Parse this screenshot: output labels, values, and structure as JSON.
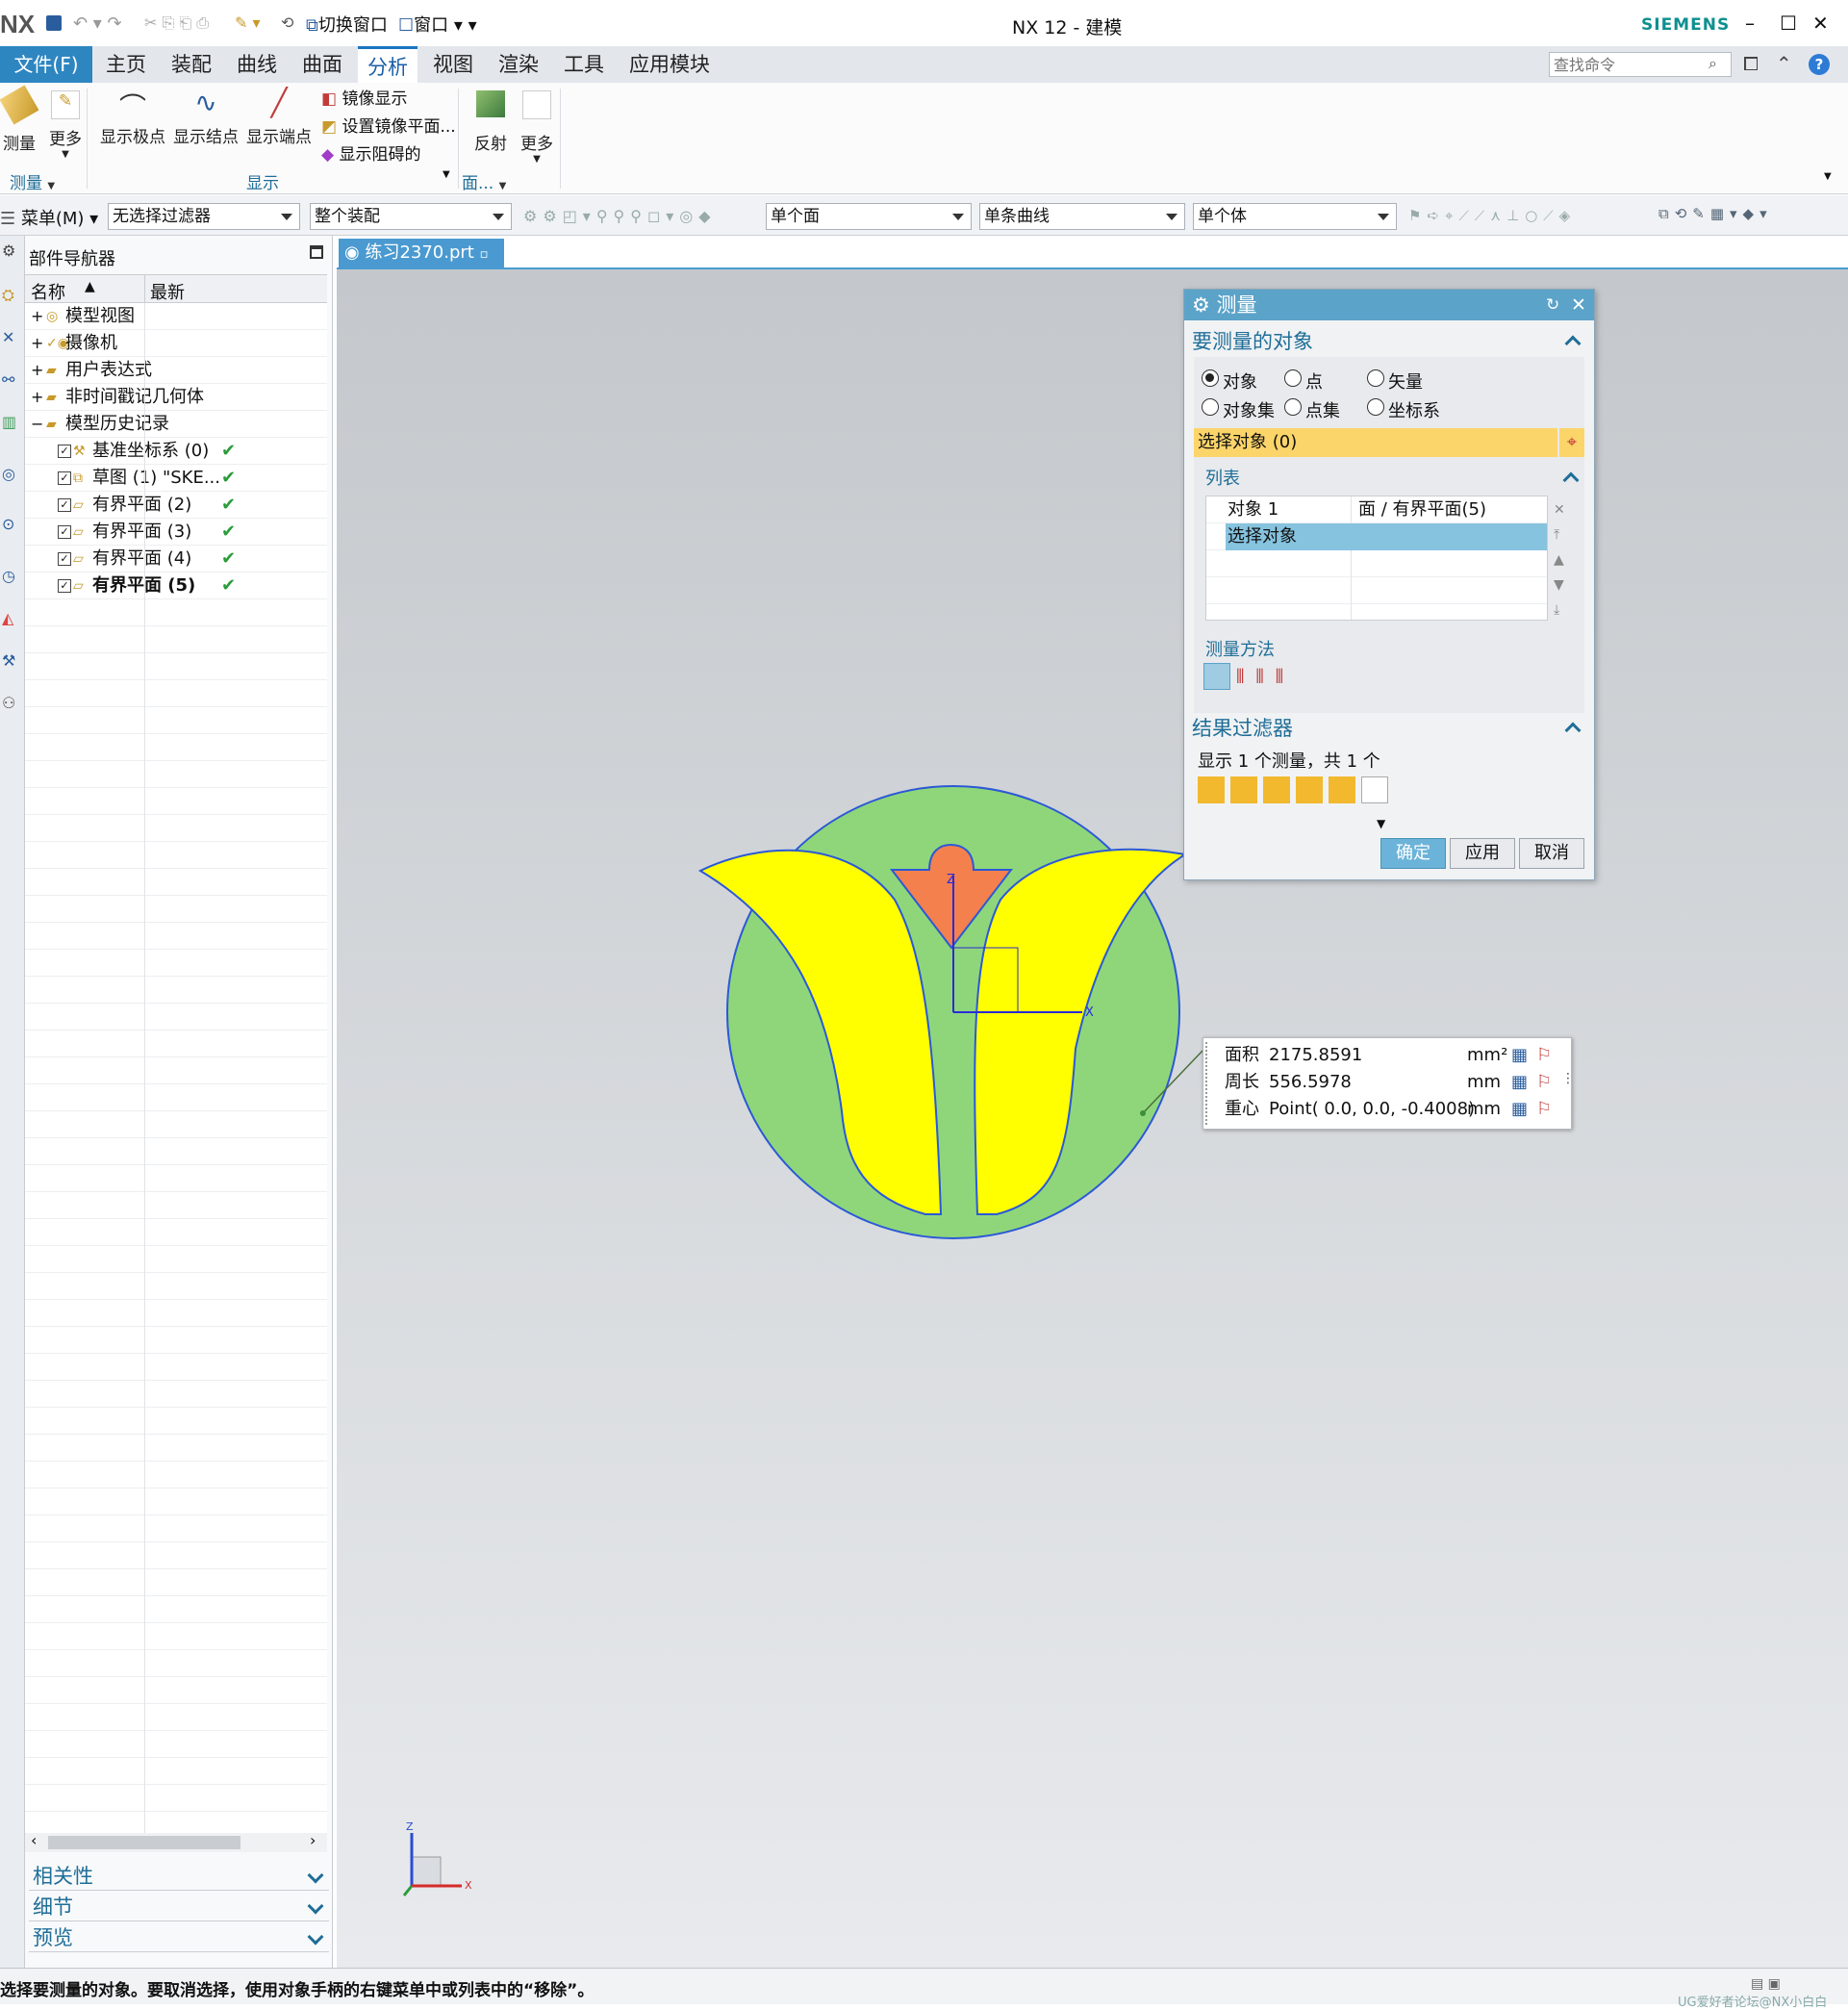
{
  "titlebar": {
    "logo": "NX",
    "quick": [
      "切换窗口",
      "窗口"
    ],
    "title": "NX 12 - 建模",
    "brand": "SIEMENS"
  },
  "menubar": {
    "file": "文件(F)",
    "tabs": [
      "主页",
      "装配",
      "曲线",
      "曲面",
      "分析",
      "视图",
      "渲染",
      "工具",
      "应用模块"
    ],
    "active_tab": "分析",
    "search_placeholder": "查找命令"
  },
  "ribbon": {
    "measure": "测量",
    "more1": "更多",
    "show_poles": "显示极点",
    "show_knots": "显示结点",
    "show_ends": "显示端点",
    "mirror_show": "镜像显示",
    "set_mirror_plane": "设置镜像平面...",
    "show_blocked": "显示阻碍的",
    "reflect": "反射",
    "more2": "更多",
    "group_measure": "测量",
    "group_show": "显示",
    "group_face": "面..."
  },
  "selbar": {
    "menu": "菜单(M)",
    "filter": "无选择过滤器",
    "assembly": "整个装配",
    "face_rule": "单个面",
    "curve_rule": "单条曲线",
    "body_rule": "单个体"
  },
  "navigator": {
    "title": "部件导航器",
    "col_name": "名称",
    "col_latest": "最新",
    "items": [
      {
        "label": "模型视图",
        "checked": false
      },
      {
        "label": "摄像机",
        "checked": false
      },
      {
        "label": "用户表达式",
        "checked": false
      },
      {
        "label": "非时间戳记几何体",
        "checked": false
      },
      {
        "label": "模型历史记录",
        "checked": false
      },
      {
        "label": "基准坐标系 (0)",
        "checked": true
      },
      {
        "label": "草图 (1) \"SKE...",
        "checked": true
      },
      {
        "label": "有界平面 (2)",
        "checked": true
      },
      {
        "label": "有界平面 (3)",
        "checked": true
      },
      {
        "label": "有界平面 (4)",
        "checked": true
      },
      {
        "label": "有界平面 (5)",
        "checked": true
      }
    ],
    "sections": [
      "相关性",
      "细节",
      "预览"
    ]
  },
  "doc_tab": "练习2370.prt",
  "dialog": {
    "title": "测量",
    "section_object": "要测量的对象",
    "radio": [
      "对象",
      "点",
      "矢量",
      "对象集",
      "点集",
      "坐标系"
    ],
    "select_object": "选择对象 (0)",
    "list_title": "列表",
    "list_rows": [
      {
        "name": "对象 1",
        "type": "面 / 有界平面(5)"
      },
      {
        "name": "选择对象",
        "type": ""
      }
    ],
    "method_title": "测量方法",
    "result_filter": "结果过滤器",
    "result_count": "显示 1 个测量，共 1 个",
    "ok": "确定",
    "apply": "应用",
    "cancel": "取消"
  },
  "measure_results": {
    "area_label": "面积",
    "area_value": "2175.8591",
    "area_unit": "mm²",
    "perimeter_label": "周长",
    "perimeter_value": "556.5978",
    "perimeter_unit": "mm",
    "centroid_label": "重心",
    "centroid_value": "Point( 0.0, 0.0, -0.4008)",
    "centroid_unit": "mm"
  },
  "status": {
    "message": "选择要测量的对象。要取消选择，使用对象手柄的右键菜单中或列表中的“移除”。",
    "watermark": "UG爱好者论坛@NX小白白"
  },
  "colors": {
    "green_disk": "#8fd67b",
    "yellow_petal": "#ffff00",
    "orange_bud": "#f4804e",
    "outline": "#2b59d6",
    "accent": "#5ba3c9"
  }
}
